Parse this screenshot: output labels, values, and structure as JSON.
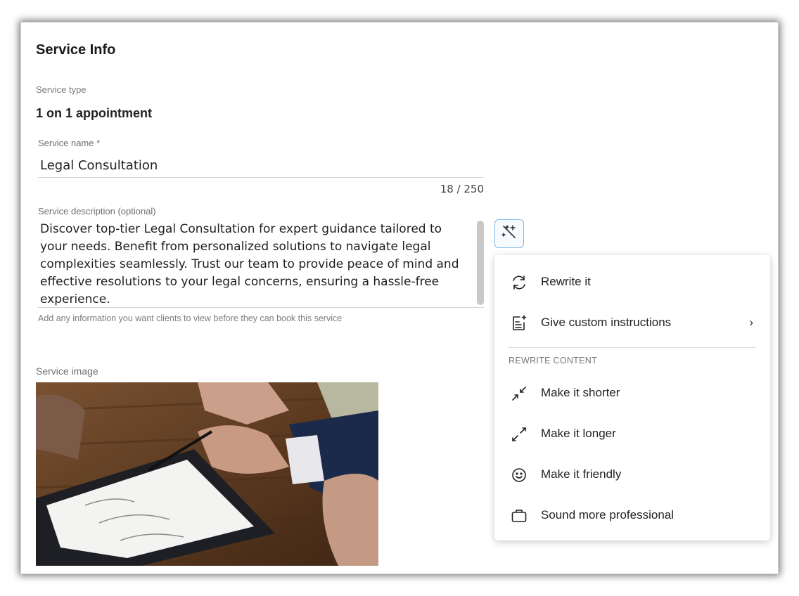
{
  "panel": {
    "title": "Service Info"
  },
  "service_type": {
    "label": "Service type",
    "value": "1 on 1 appointment"
  },
  "service_name": {
    "label": "Service name *",
    "value": "Legal Consultation",
    "counter": "18 / 250"
  },
  "service_description": {
    "label": "Service description (optional)",
    "value": "Discover top-tier Legal Consultation for expert guidance tailored to your needs. Benefit from personalized solutions to navigate legal complexities seamlessly. Trust our team to provide peace of mind and effective resolutions to your legal concerns, ensuring a hassle-free experience.",
    "helper": "Add any information you want clients to view before they can book this service"
  },
  "service_image": {
    "label": "Service image"
  },
  "ai_button": {
    "icon": "magic-wand-icon",
    "accent": "#7fb8e8"
  },
  "ai_menu": {
    "items_top": [
      {
        "label": "Rewrite it",
        "icon": "refresh-icon"
      },
      {
        "label": "Give custom instructions",
        "icon": "edit-note-icon",
        "submenu": "›"
      }
    ],
    "section_title": "REWRITE CONTENT",
    "items_rewrite": [
      {
        "label": "Make it shorter",
        "icon": "collapse-arrows-icon"
      },
      {
        "label": "Make it longer",
        "icon": "expand-arrows-icon"
      },
      {
        "label": "Make it friendly",
        "icon": "smiley-icon"
      },
      {
        "label": "Sound more professional",
        "icon": "briefcase-icon"
      }
    ]
  }
}
